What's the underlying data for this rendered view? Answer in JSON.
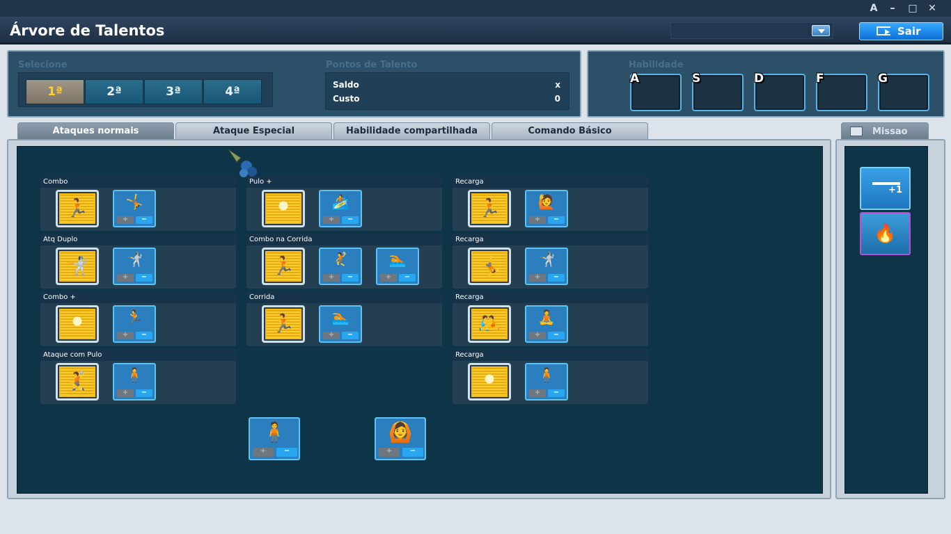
{
  "window": {
    "title": "Árvore de Talentos",
    "controls": [
      "A",
      "–",
      "□",
      "✕"
    ],
    "exit_label": "Sair"
  },
  "select": {
    "label": "Selecione",
    "tabs": [
      "1ª",
      "2ª",
      "3ª",
      "4ª"
    ],
    "active": 0
  },
  "points": {
    "label": "Pontos de Talento",
    "balance_label": "Saldo",
    "balance_value": "x",
    "cost_label": "Custo",
    "cost_value": "0"
  },
  "skills": {
    "label": "Habilidade",
    "keys": [
      "A",
      "S",
      "D",
      "F",
      "G"
    ]
  },
  "tabs": [
    "Ataques normais",
    "Ataque Especial",
    "Habilidade compartilhada",
    "Comando Básico"
  ],
  "mission_tab": "Missao",
  "mission_icon_text": "+1",
  "rows": [
    {
      "label": "Combo"
    },
    {
      "label": "Atq Duplo"
    },
    {
      "label": "Combo +"
    },
    {
      "label": "Ataque com Pulo"
    },
    {
      "label": "Pulo +"
    },
    {
      "label": "Combo na Corrida"
    },
    {
      "label": "Corrida"
    },
    {
      "label": "Recarga"
    },
    {
      "label": "Recarga"
    },
    {
      "label": "Recarga"
    },
    {
      "label": "Recarga"
    }
  ],
  "buttons": {
    "plus": "+",
    "minus": "−"
  },
  "colors": {
    "background": "#dde3ea",
    "panel": "#2b5068",
    "area": "#0d3447",
    "icon_gold": "#f3bf17",
    "slot_blue": "#2c7fbf",
    "accent": "#1a8cf0"
  },
  "icons": {
    "main": "silhouette-fighter-icon",
    "pattern": "burst-pattern-icon",
    "mission": "scroll-icon"
  }
}
